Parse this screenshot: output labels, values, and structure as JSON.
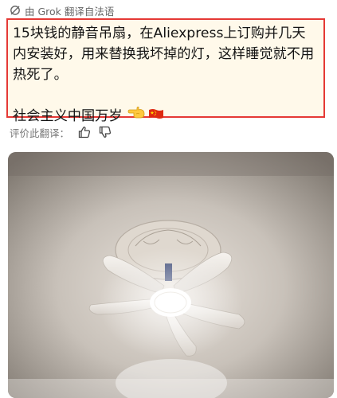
{
  "header": {
    "text": "由 Grok 翻译自法语",
    "icon": "grok-icon"
  },
  "translation": {
    "paragraph1": "15块钱的静音吊扇，在Aliexpress上订购并几天内安装好，用来替换我坏掉的灯，这样睡觉就不用热死了。",
    "paragraph2": "社会主义中国万岁",
    "emojis": [
      "point-left-hand-emoji",
      "china-flag-emoji"
    ]
  },
  "rating": {
    "label": "评价此翻译：",
    "icons": [
      "thumbs-up-icon",
      "thumbs-down-icon"
    ]
  },
  "photo": {
    "subject": "ceiling-fan-light-photo"
  },
  "colors": {
    "highlight_border": "#e53935",
    "box_background": "#fff9ea",
    "flag_red": "#de2910",
    "flag_star": "#ffde00"
  }
}
